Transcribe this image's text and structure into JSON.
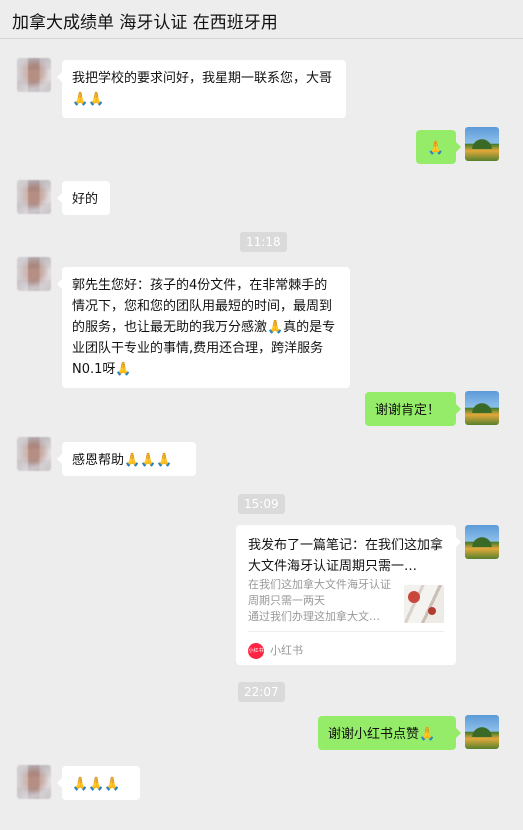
{
  "window": {
    "title": "加拿大成绩单 海牙认证 在西班牙用"
  },
  "messages": [
    {
      "text": "我把学校的要求问好，我星期一联系您，大哥🙏🙏"
    },
    {
      "text": "🙏"
    },
    {
      "text": "好的"
    },
    {
      "time": "11:18"
    },
    {
      "text": "郭先生您好：孩子的4份文件，在非常棘手的情况下，您和您的团队用最短的时间，最周到的服务，也让最无助的我万分感激🙏真的是专业团队干专业的事情,费用还合理，跨洋服务N0.1呀🙏"
    },
    {
      "text": "谢谢肯定！"
    },
    {
      "text": "感恩帮助🙏🙏🙏"
    },
    {
      "time": "15:09"
    },
    {
      "card": {
        "title": "我发布了一篇笔记：在我们这加拿大文件海牙认证周期只需一…",
        "desc": "在我们这加拿大文件海牙认证周期只需一两天\n通过我们办理这加拿大文…",
        "logo": "小红书",
        "source": "小红书"
      }
    },
    {
      "time": "22:07"
    },
    {
      "text": "谢谢小红书点赞🙏"
    },
    {
      "text": "🙏🙏🙏"
    }
  ],
  "colors": {
    "self_bubble": "#95ec69",
    "other_bubble": "#ffffff",
    "background": "#ededed"
  }
}
